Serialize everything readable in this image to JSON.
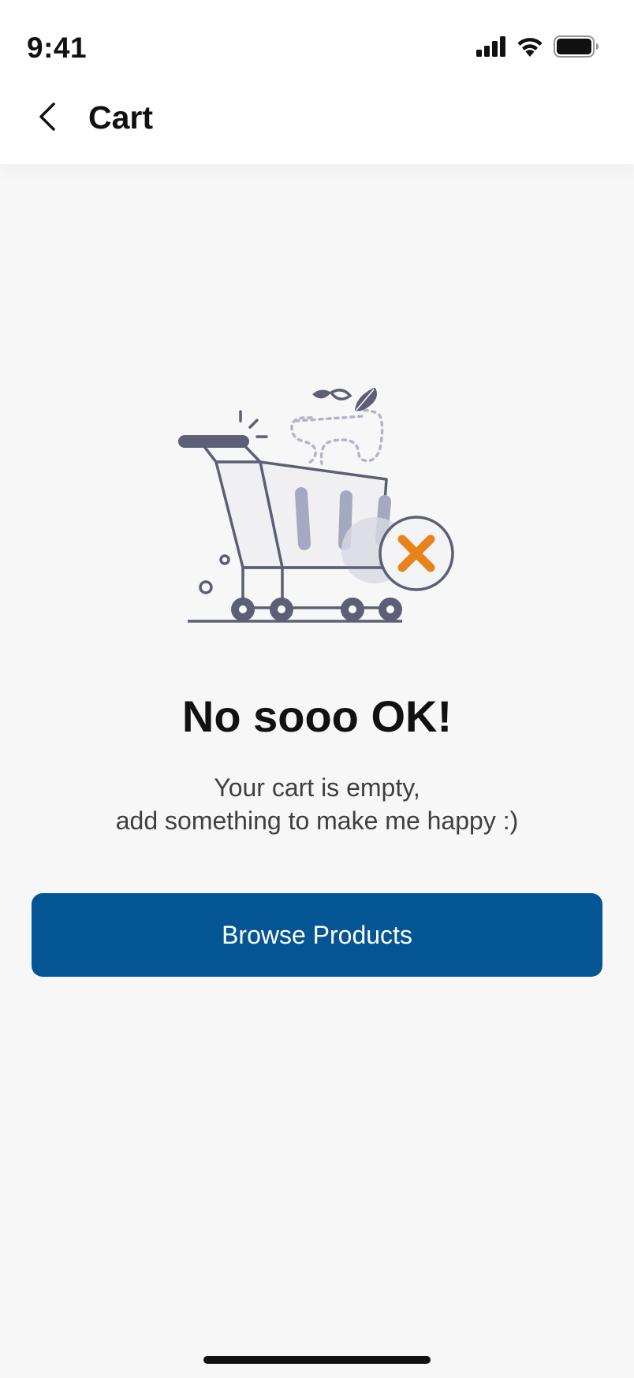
{
  "status_bar": {
    "time": "9:41",
    "icons": [
      "cellular-signal-icon",
      "wifi-icon",
      "battery-icon"
    ]
  },
  "nav": {
    "back_icon": "chevron-left-icon",
    "title": "Cart"
  },
  "empty_state": {
    "illustration": "empty-cart-icon",
    "headline": "No sooo OK!",
    "message_line1": "Your cart is empty,",
    "message_line2": "add something to make me happy :)"
  },
  "actions": {
    "browse_label": "Browse Products"
  },
  "colors": {
    "primary": "#045593",
    "background": "#f7f7f8",
    "illustration_stroke": "#5c5f75",
    "illustration_bars": "#a4a8c0",
    "remove_badge": "#e8831a"
  }
}
